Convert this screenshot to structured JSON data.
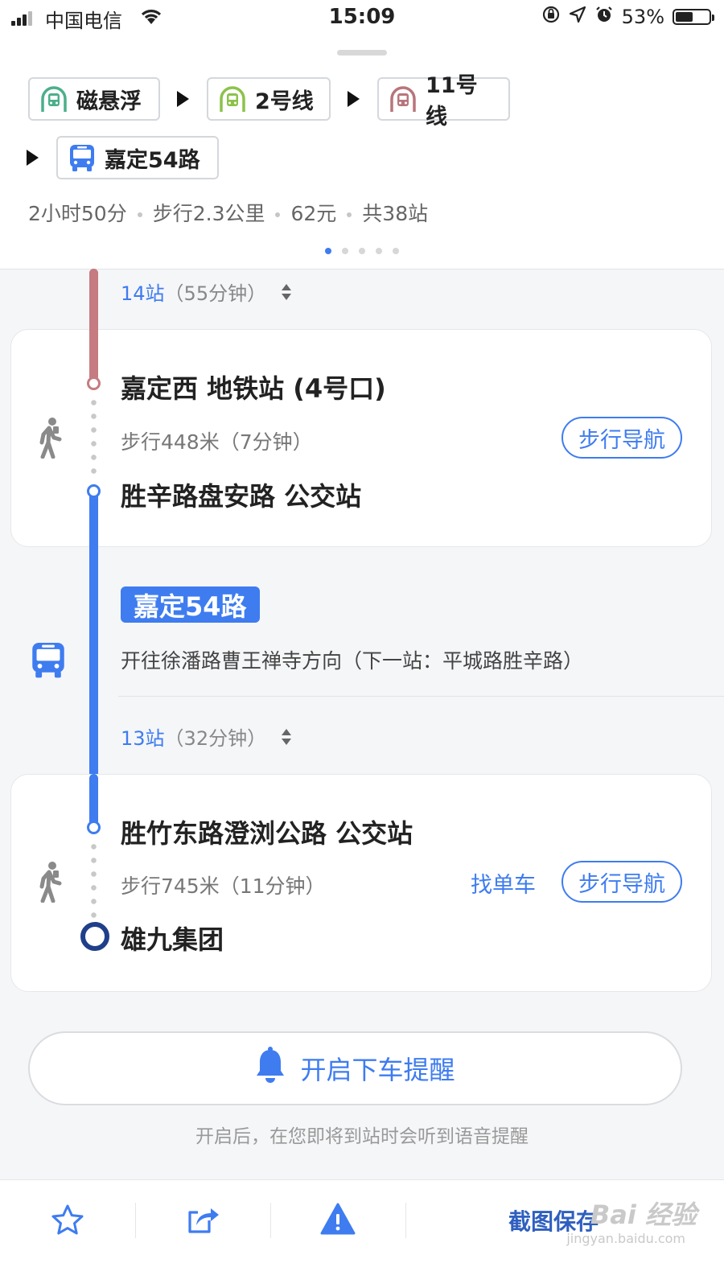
{
  "status_bar": {
    "carrier": "中国电信",
    "time": "15:09",
    "battery": "53%",
    "battery_level": 0.53
  },
  "summary": {
    "chips": [
      {
        "label": "磁悬浮",
        "icon": "metro-icon",
        "color": "#4caf8a"
      },
      {
        "label": "2号线",
        "icon": "metro-icon",
        "color": "#8bc34a"
      },
      {
        "label": "11号线",
        "icon": "metro-icon",
        "color": "#b8757c"
      },
      {
        "label": "嘉定54路",
        "icon": "bus-icon",
        "color": "#3e7cf0"
      }
    ],
    "duration": "2小时50分",
    "walk_distance": "步行2.3公里",
    "price": "62元",
    "stops_total": "共38站",
    "page_count": 5,
    "active_page": 1
  },
  "route": {
    "metro_segment": {
      "stops": "14站",
      "duration": "（55分钟）",
      "color": "#c57b81"
    },
    "walk1": {
      "from": "嘉定西 地铁站 (4号口)",
      "desc": "步行448米（7分钟）",
      "to": "胜辛路盘安路 公交站",
      "nav_label": "步行导航"
    },
    "bus": {
      "tag": "嘉定54路",
      "direction": "开往徐潘路曹王禅寺方向（下一站：平城路胜辛路）",
      "stops": "13站",
      "duration": "（32分钟）",
      "color": "#3e7cf0"
    },
    "walk2": {
      "from": "胜竹东路澄浏公路 公交站",
      "desc": "步行745米（11分钟）",
      "bike_label": "找单车",
      "nav_label": "步行导航",
      "destination": "雄九集团"
    }
  },
  "reminder": {
    "button_label": "开启下车提醒",
    "hint": "开启后，在您即将到站时会听到语音提醒"
  },
  "toolbar": {
    "save_label": "截图保存",
    "items": [
      "star-icon",
      "share-icon",
      "warning-icon"
    ]
  },
  "watermark": {
    "text": "Bai 经验",
    "sub": "jingyan.baidu.com"
  },
  "colors": {
    "accent": "#3e7cf0",
    "metro_line": "#c57b81",
    "text": "#222222"
  }
}
